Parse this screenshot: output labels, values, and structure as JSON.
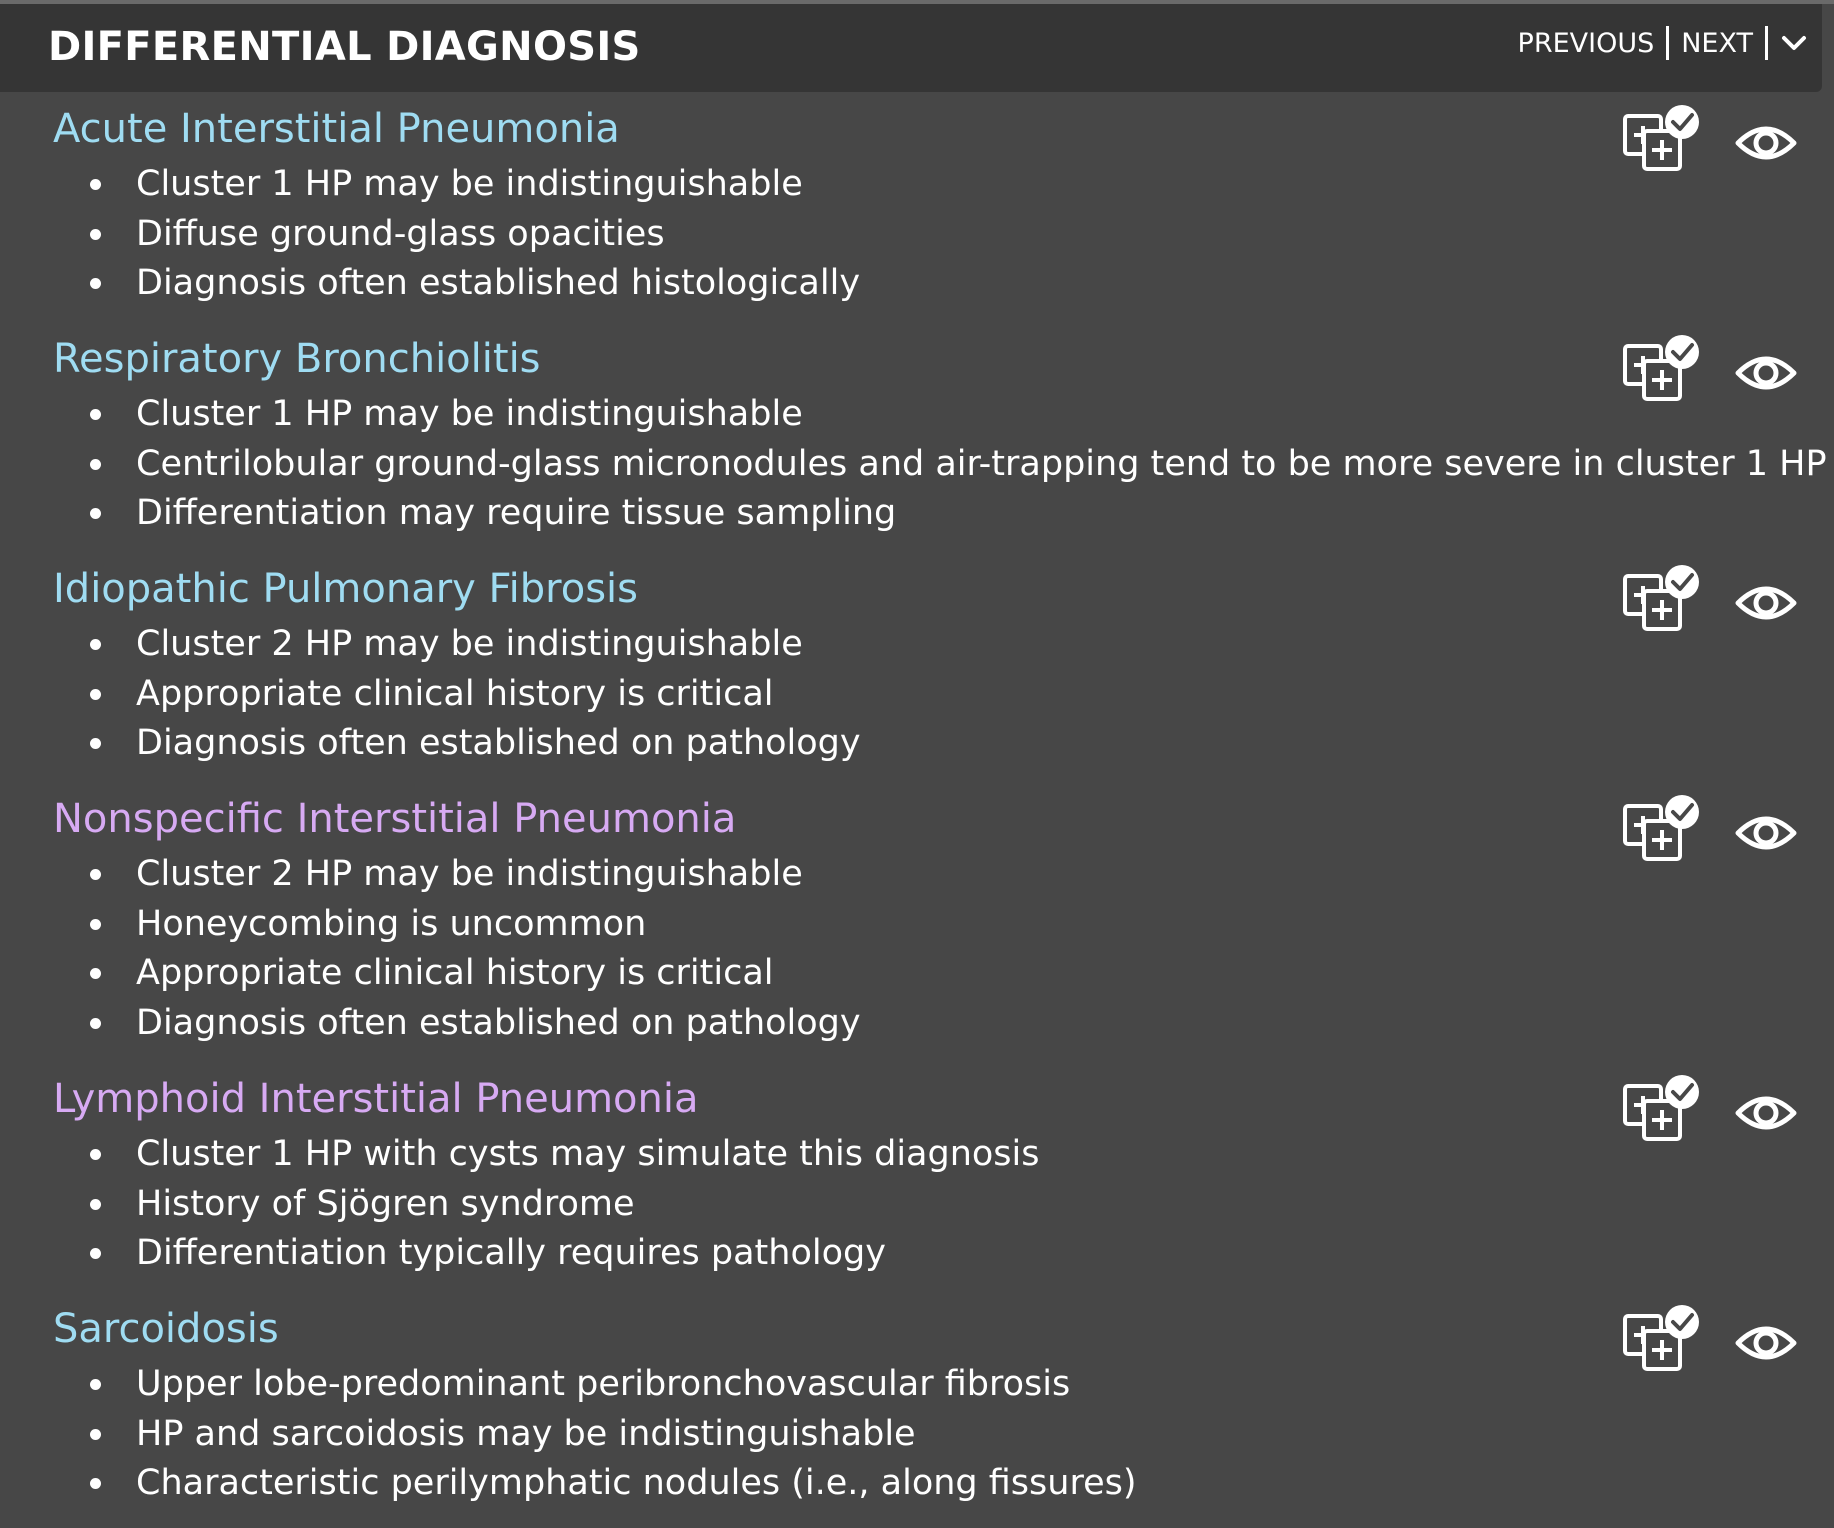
{
  "header": {
    "title": "DIFFERENTIAL DIAGNOSIS",
    "previous_label": "PREVIOUS",
    "next_label": "NEXT",
    "collapse_icon": "chevron-down-icon"
  },
  "colors": {
    "background": "#474747",
    "header": "#353535",
    "title_blue": "#9fdcf2",
    "title_purple": "#d7aaf3"
  },
  "entries": [
    {
      "title": "Acute Interstitial Pneumonia",
      "color": "blue",
      "bullets": [
        "Cluster 1 HP may be indistinguishable",
        "Diffuse ground-glass opacities",
        "Diagnosis often established histologically"
      ]
    },
    {
      "title": "Respiratory Bronchiolitis",
      "color": "blue",
      "bullets": [
        "Cluster 1 HP may be indistinguishable",
        "Centrilobular ground-glass micronodules and air-trapping tend to be more severe in cluster 1 HP",
        "Differentiation may require tissue sampling"
      ]
    },
    {
      "title": "Idiopathic Pulmonary Fibrosis",
      "color": "blue",
      "bullets": [
        "Cluster 2 HP may be indistinguishable",
        "Appropriate clinical history is critical",
        "Diagnosis often established on pathology"
      ]
    },
    {
      "title": "Nonspecific Interstitial Pneumonia",
      "color": "purple",
      "bullets": [
        "Cluster 2 HP may be indistinguishable",
        "Honeycombing is uncommon",
        "Appropriate clinical history is critical",
        "Diagnosis often established on pathology"
      ]
    },
    {
      "title": "Lymphoid Interstitial Pneumonia",
      "color": "purple",
      "bullets": [
        "Cluster 1 HP with cysts may simulate this diagnosis",
        "History of Sjögren syndrome",
        "Differentiation typically requires pathology"
      ]
    },
    {
      "title": "Sarcoidosis",
      "color": "blue",
      "bullets": [
        "Upper lobe-predominant peribronchovascular fibrosis",
        "HP and sarcoidosis may be indistinguishable",
        "Characteristic perilymphatic nodules (i.e., along fissures)"
      ]
    }
  ],
  "entry_icons": [
    "ddx-compare-icon",
    "eye-icon"
  ]
}
